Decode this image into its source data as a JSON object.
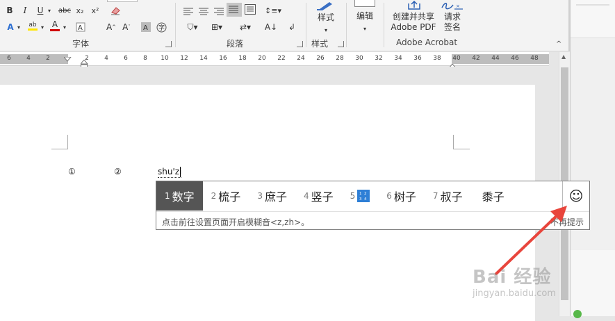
{
  "ribbon": {
    "font_group_label": "字体",
    "paragraph_group_label": "段落",
    "styles_group_label": "样式",
    "styles_button": "样式",
    "edit_button": "编辑",
    "adobe_create_share_line1": "创建并共享",
    "adobe_create_share_line2": "Adobe PDF",
    "adobe_request_line1": "请求",
    "adobe_request_line2": "签名",
    "adobe_group_label": "Adobe Acrobat"
  },
  "ruler": {
    "ticks": [
      "6",
      "4",
      "2",
      "2",
      "4",
      "6",
      "8",
      "10",
      "12",
      "14",
      "16",
      "18",
      "20",
      "22",
      "24",
      "26",
      "28",
      "30",
      "32",
      "34",
      "36",
      "38",
      "40",
      "42",
      "44",
      "46",
      "48"
    ]
  },
  "document": {
    "marker1": "①",
    "marker2": "②",
    "typed_text": "shu'zi"
  },
  "ime": {
    "candidates": [
      {
        "num": "1",
        "text": "数字"
      },
      {
        "num": "2",
        "text": "梳子"
      },
      {
        "num": "3",
        "text": "庶子"
      },
      {
        "num": "4",
        "text": "竖子"
      },
      {
        "num": "5",
        "text": ""
      },
      {
        "num": "6",
        "text": "树子"
      },
      {
        "num": "7",
        "text": "叔子"
      },
      {
        "num": "",
        "text": "黍子"
      }
    ],
    "hint": "点击前往设置页面开启模糊音<z,zh>。",
    "hint_right": "不再提示",
    "emoji_glyph": "☺"
  },
  "watermark": {
    "brand": "Bai 经验",
    "url": "jingyan.baidu.com"
  },
  "colors": {
    "selected_candidate_bg": "#555555",
    "arrow": "#e8453c",
    "font_color_red": "#d00000",
    "highlight_yellow": "#ffe600"
  }
}
